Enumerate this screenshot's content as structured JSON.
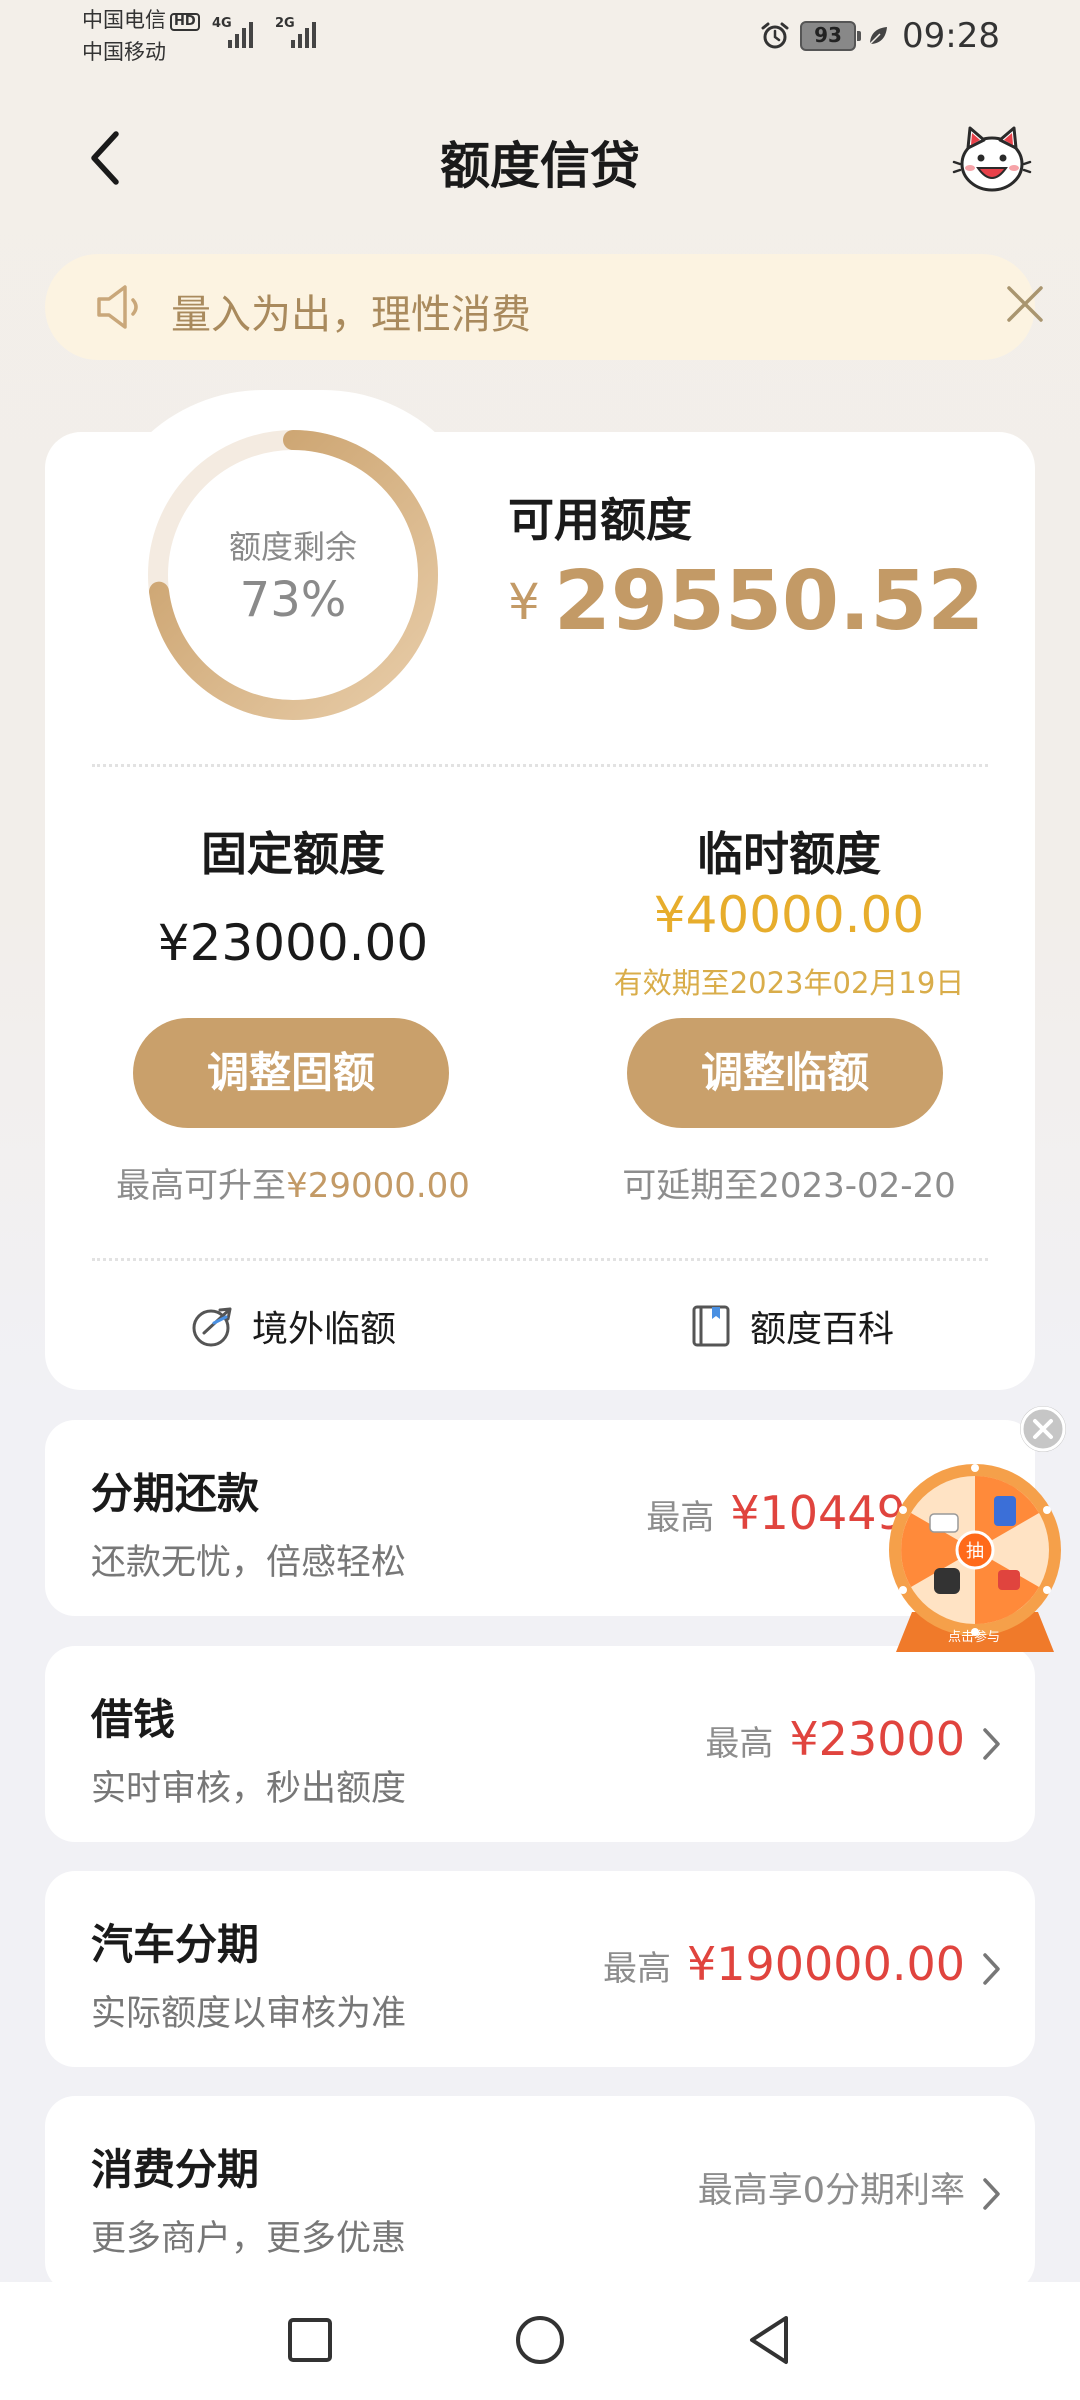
{
  "status_bar": {
    "carrier1": "中国电信",
    "carrier1_badge": "HD",
    "carrier2": "中国移动",
    "net1": "4G",
    "net2": "2G",
    "battery": "93",
    "time": "09:28"
  },
  "header": {
    "title": "额度信贷"
  },
  "notice": {
    "text": "量入为出，理性消费"
  },
  "credit": {
    "ring_label": "额度剩余",
    "ring_value": "73%",
    "ring_fraction": 0.73,
    "available_label": "可用额度",
    "currency": "¥",
    "available_amount": "29550.52",
    "fixed": {
      "title": "固定额度",
      "amount": "¥23000.00",
      "button": "调整固额",
      "note_prefix": "最高可升至",
      "note_amount": "¥29000.00"
    },
    "temp": {
      "title": "临时额度",
      "amount": "¥40000.00",
      "expiry": "有效期至2023年02月19日",
      "button": "调整临额",
      "note": "可延期至2023-02-20"
    },
    "links": {
      "overseas": "境外临额",
      "encyclopedia": "额度百科"
    }
  },
  "services": [
    {
      "title": "分期还款",
      "subtitle": "还款无忧，倍感轻松",
      "prefix": "最高",
      "amount": "¥10449.00"
    },
    {
      "title": "借钱",
      "subtitle": "实时审核，秒出额度",
      "prefix": "最高",
      "amount": "¥23000"
    },
    {
      "title": "汽车分期",
      "subtitle": "实际额度以审核为准",
      "prefix": "最高",
      "amount": "¥190000.00"
    },
    {
      "title": "消费分期",
      "subtitle": "更多商户，更多优惠",
      "text": "最高享0分期利率"
    }
  ],
  "wheel": {
    "center": "抽",
    "caption": "点击参与"
  },
  "colors": {
    "gold": "#c9a06b",
    "amount_red": "#e0443e",
    "temp_yellow": "#e7ad2c",
    "notice_bg": "#fcf3e1"
  }
}
